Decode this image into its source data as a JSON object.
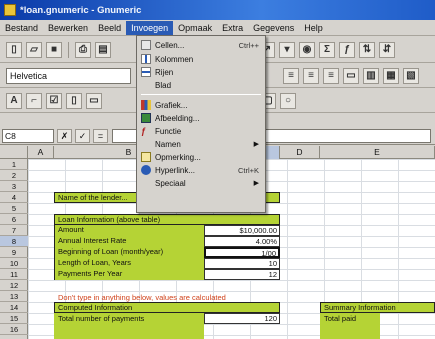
{
  "window": {
    "title": "*loan.gnumeric - Gnumeric"
  },
  "menubar": {
    "items": [
      "Bestand",
      "Bewerken",
      "Beeld",
      "Invoegen",
      "Opmaak",
      "Extra",
      "Gegevens",
      "Help"
    ]
  },
  "toolbar": {
    "font_name": "Helvetica"
  },
  "formula_bar": {
    "cell_ref": "C8"
  },
  "columns": [
    "A",
    "B",
    "C",
    "D",
    "E"
  ],
  "rows": [
    "1",
    "2",
    "3",
    "4",
    "5",
    "6",
    "7",
    "8",
    "9",
    "10",
    "11",
    "12",
    "13",
    "14",
    "15",
    "16"
  ],
  "sheet": {
    "header_text": "Name of the lender...",
    "loan_header": "Loan Information (above table)",
    "loan_rows": [
      {
        "label": "Amount",
        "value": "$10,000.00"
      },
      {
        "label": "Annual Interest Rate",
        "value": "4.00%"
      },
      {
        "label": "Beginning of Loan (month/year)",
        "value": "1/00"
      },
      {
        "label": "Length of Loan, Years",
        "value": "10"
      },
      {
        "label": "Payments Per Year",
        "value": "12"
      }
    ],
    "warning": "Don't type in anything below, values are calculated",
    "computed_header": "Computed Information",
    "computed_row": "Total number of payments",
    "computed_value": "120",
    "summary_header": "Summary Information",
    "summary_row": "Total paid"
  },
  "dropdown": {
    "items": [
      {
        "label": "Cellen...",
        "shortcut": "Ctrl++",
        "icon": "cells-icon"
      },
      {
        "label": "Kolommen",
        "shortcut": "",
        "icon": "columns-icon"
      },
      {
        "label": "Rijen",
        "shortcut": "",
        "icon": "rows-icon"
      },
      {
        "label": "Blad",
        "shortcut": "",
        "icon": "sheet-icon"
      },
      {
        "label": "Grafiek...",
        "shortcut": "",
        "icon": "chart-icon"
      },
      {
        "label": "Afbeelding...",
        "shortcut": "",
        "icon": "image-icon"
      },
      {
        "label": "Functie",
        "shortcut": "",
        "icon": "function-icon"
      },
      {
        "label": "Namen",
        "shortcut": "",
        "icon": "names-icon",
        "submenu": true
      },
      {
        "label": "Opmerking...",
        "shortcut": "",
        "icon": "comment-icon"
      },
      {
        "label": "Hyperlink...",
        "shortcut": "Ctrl+K",
        "icon": "hyperlink-icon"
      },
      {
        "label": "Speciaal",
        "shortcut": "",
        "icon": "special-icon",
        "submenu": true
      }
    ]
  },
  "colors": {
    "lime": "#b5d335",
    "menu_highlight": "#2a5bb5",
    "title_blue": "#0a3aa8"
  }
}
